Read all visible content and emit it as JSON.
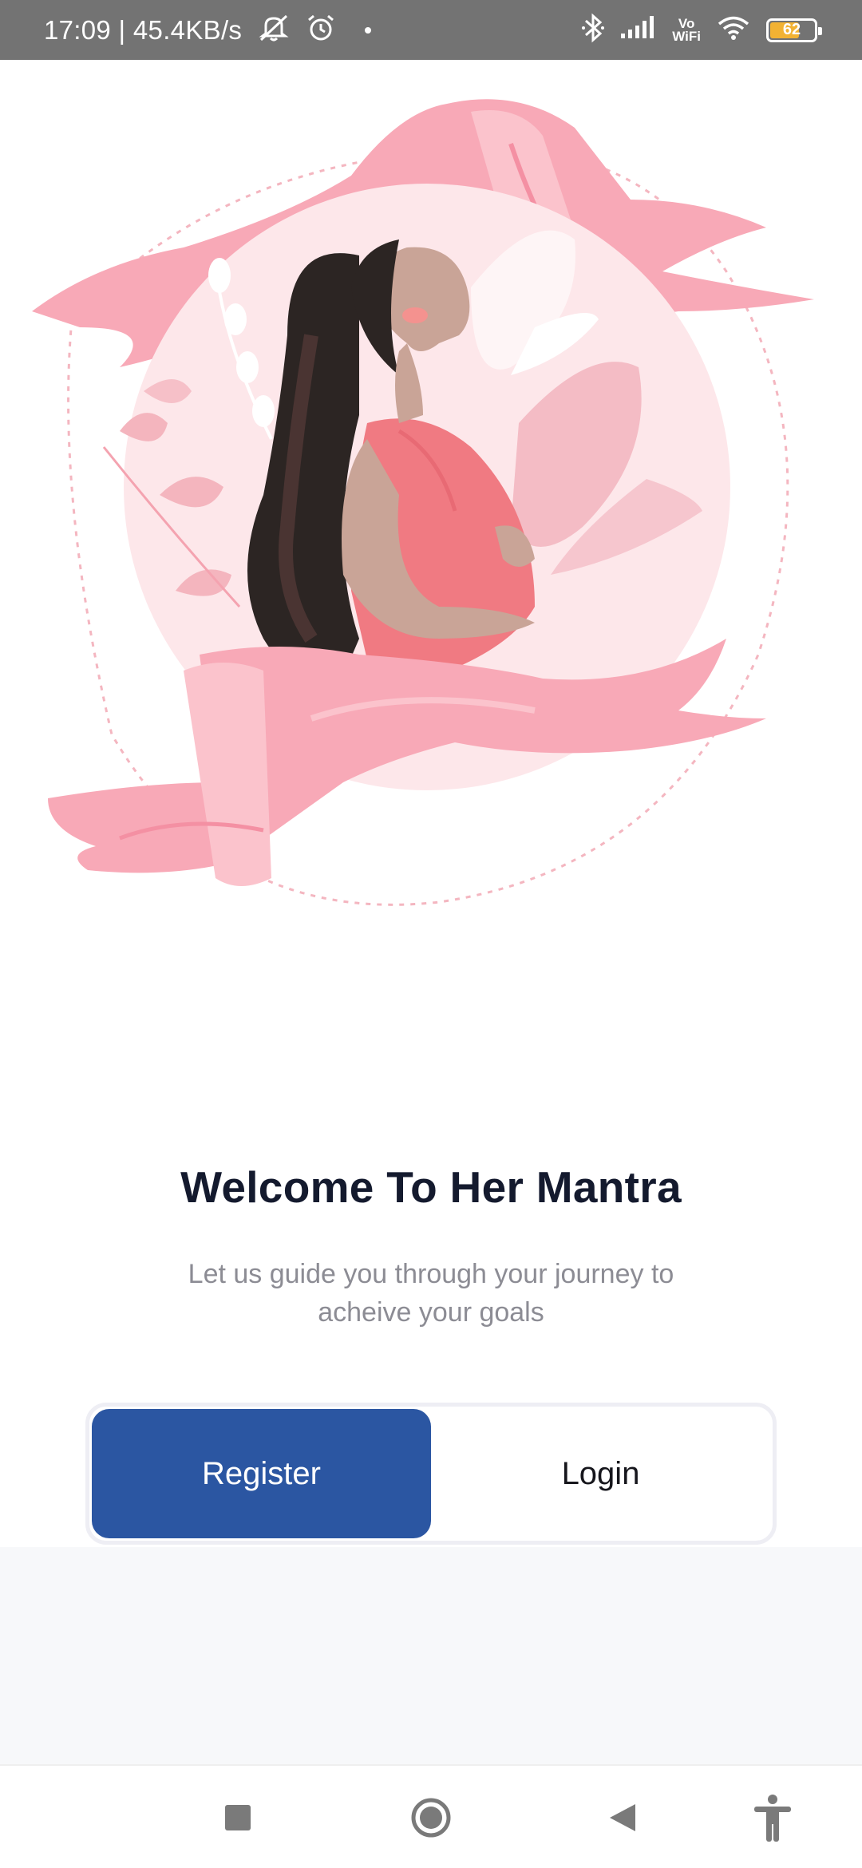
{
  "status_bar": {
    "time_speed": "17:09 | 45.4KB/s",
    "icons_left": [
      "mute-icon",
      "alarm-icon",
      "dot"
    ],
    "icons_right": [
      "bluetooth-icon",
      "signal-icon",
      "vowifi-icon",
      "wifi-icon",
      "battery-icon"
    ],
    "vowifi_line1": "Vo",
    "vowifi_line2": "WiFi",
    "battery_level": "62"
  },
  "hero": {
    "illustration": "pregnant-woman-illustration",
    "accent_color": "#f8a5b3"
  },
  "welcome": {
    "title": "Welcome To Her Mantra",
    "subtitle": "Let us guide you through your journey to acheive your goals"
  },
  "auth_toggle": {
    "register_label": "Register",
    "login_label": "Login",
    "selected": "Register",
    "primary_color": "#2b56a2"
  },
  "nav_bar": {
    "items": [
      "recents-button",
      "home-button",
      "back-button",
      "accessibility-button"
    ]
  }
}
